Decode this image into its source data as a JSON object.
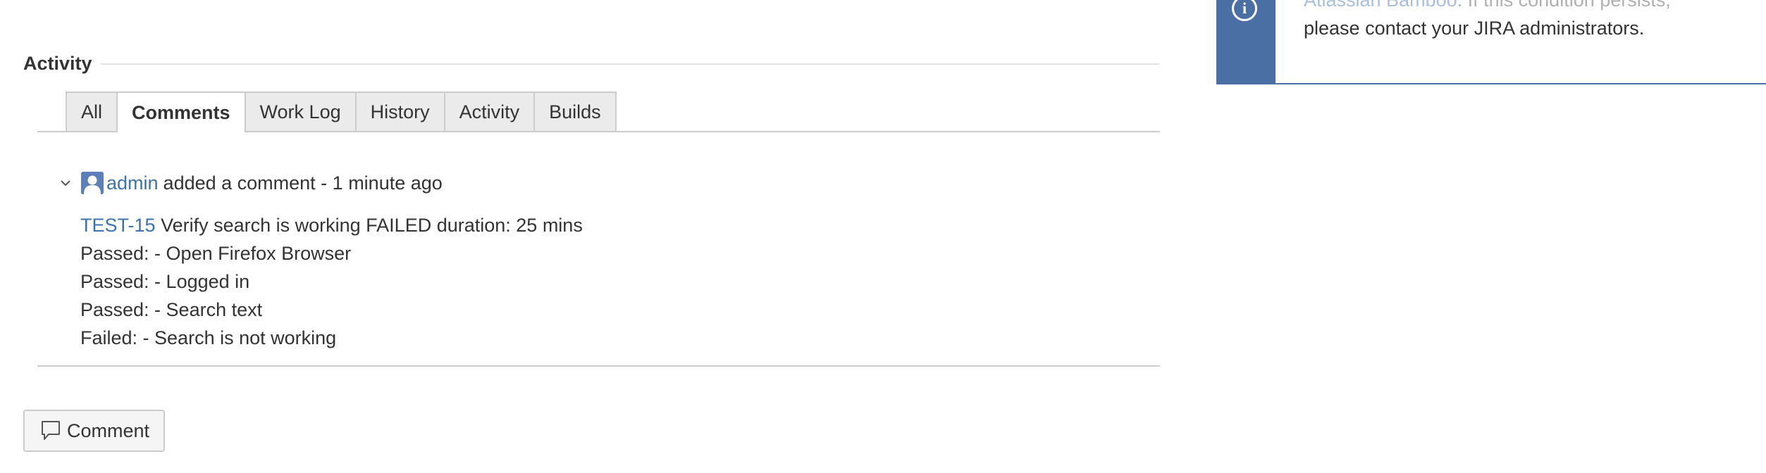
{
  "info_message": {
    "link_text": "Atlassian Bamboo",
    "line1_rest": ". If this condition persists,",
    "line2": "please contact your JIRA administrators.",
    "icon": "info-icon"
  },
  "activity": {
    "title": "Activity",
    "tabs": [
      {
        "label": "All",
        "active": false
      },
      {
        "label": "Comments",
        "active": true
      },
      {
        "label": "Work Log",
        "active": false
      },
      {
        "label": "History",
        "active": false
      },
      {
        "label": "Activity",
        "active": false
      },
      {
        "label": "Builds",
        "active": false
      }
    ]
  },
  "comment": {
    "author": "admin",
    "action_text": "added a comment - 1 minute ago",
    "avatar_icon": "user-avatar-icon",
    "toggle_icon": "chevron-down-icon",
    "issue_key": "TEST-15",
    "summary": "Verify search is working FAILED duration: 25 mins",
    "lines": [
      "Passed: - Open Firefox Browser",
      "Passed: - Logged in",
      "Passed: - Search text",
      "Failed: - Search is not working"
    ]
  },
  "actions": {
    "comment_button_label": "Comment",
    "comment_button_icon": "speech-bubble-icon"
  },
  "colors": {
    "link": "#3b73af",
    "info_stripe": "#4a6fa5",
    "tab_background": "#ebebeb",
    "border": "#cccccc"
  }
}
